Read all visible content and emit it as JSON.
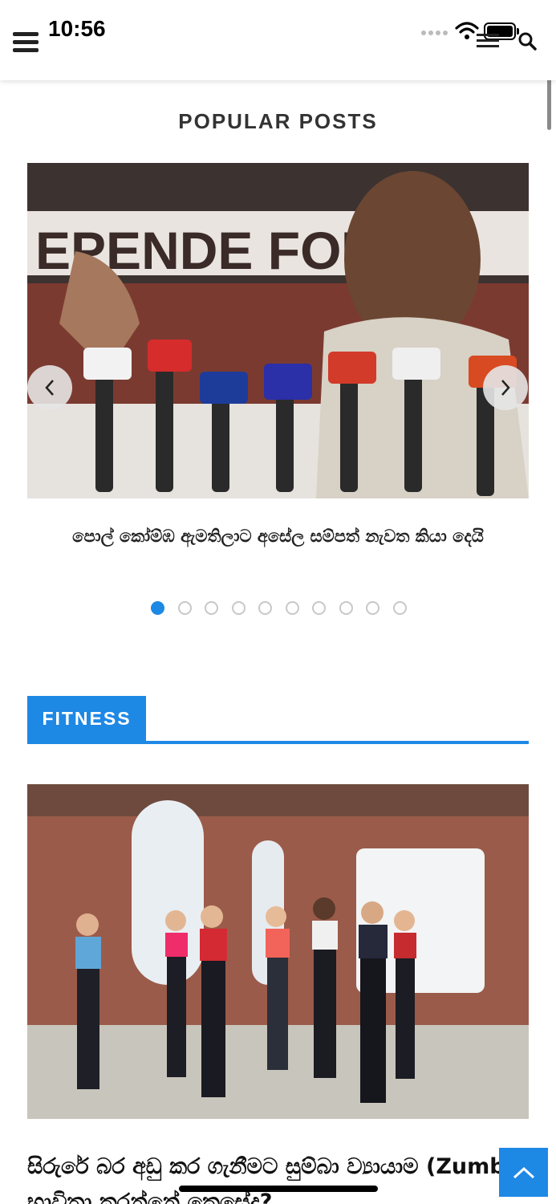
{
  "status_bar": {
    "time": "10:56"
  },
  "header": {
    "menu_icon": "hamburger-menu-icon",
    "nav_icon": "menu-lines-icon",
    "search_icon": "search-icon"
  },
  "popular_posts": {
    "title": "POPULAR POSTS",
    "slide_caption": "පොල් කෝම්ඹ ඇමතිලාට අසේල සම්පත් නැවත කියා දෙයි",
    "image_description_icon": "press-conference-photo",
    "prev_icon": "chevron-left-icon",
    "next_icon": "chevron-right-icon",
    "dot_count": 10,
    "active_dot": 0
  },
  "fitness": {
    "tab_label": "FITNESS",
    "article_title": "සිරුරේ බර අඩු කර ගැනීමට සුම්බා ව්‍යායාම (Zumba) භාවිතා කරන්නේ කෙසේද?"
  },
  "colors": {
    "accent": "#1e88e5",
    "dot_inactive": "#c8c8c8"
  }
}
